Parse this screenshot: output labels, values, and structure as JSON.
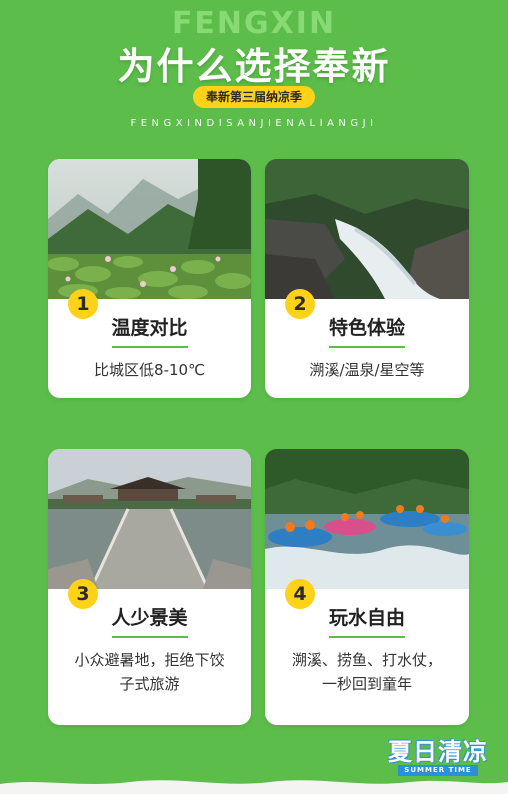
{
  "header": {
    "brand_en": "FENGXIN",
    "title": "为什么选择奉新",
    "pill": "奉新第三届纳凉季",
    "pinyin": "FENGXINDISANJIENALIANGJI"
  },
  "cards": [
    {
      "number": "1",
      "title": "温度对比",
      "desc": "比城区低8-10℃"
    },
    {
      "number": "2",
      "title": "特色体验",
      "desc": "溯溪/温泉/星空等"
    },
    {
      "number": "3",
      "title": "人少景美",
      "desc": "小众避暑地，拒绝下饺子式旅游"
    },
    {
      "number": "4",
      "title": "玩水自由",
      "desc": "溯溪、捞鱼、打水仗，一秒回到童年"
    }
  ],
  "footer": {
    "logo_cn": "夏日清凉",
    "logo_en": "SUMMER TIME"
  },
  "colors": {
    "background": "#5cbd4a",
    "accent": "#ffd21a",
    "logo_blue": "#2d8fd6"
  }
}
